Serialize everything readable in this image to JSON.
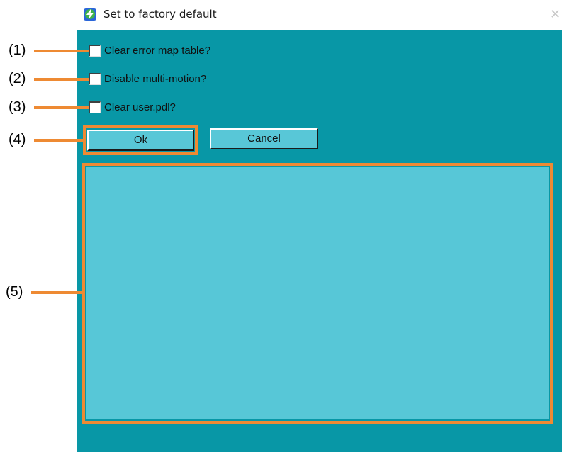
{
  "window": {
    "title": "Set to factory default",
    "icon": "app-lightning-icon",
    "close_icon": "close-icon"
  },
  "checkboxes": [
    {
      "label": "Clear error map table?",
      "checked": false
    },
    {
      "label": "Disable multi-motion?",
      "checked": false
    },
    {
      "label": "Clear user.pdl?",
      "checked": false
    }
  ],
  "buttons": {
    "ok_label": "Ok",
    "cancel_label": "Cancel"
  },
  "callouts": [
    "(1)",
    "(2)",
    "(3)",
    "(4)",
    "(5)"
  ],
  "colors": {
    "client_background": "#0897a6",
    "control_background": "#58c7d7",
    "highlight": "#ee8a33"
  }
}
